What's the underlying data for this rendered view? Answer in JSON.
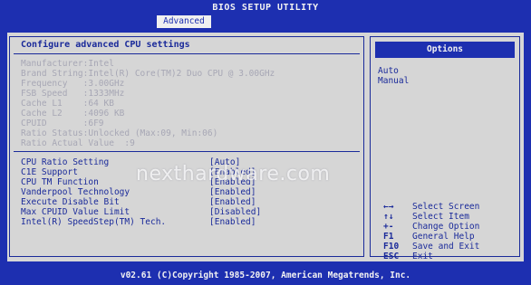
{
  "header": {
    "title": "BIOS SETUP UTILITY",
    "active_tab": "Advanced"
  },
  "left": {
    "heading": "Configure advanced CPU settings",
    "info": [
      "Manufacturer:Intel",
      "Brand String:Intel(R) Core(TM)2 Duo CPU @ 3.00GHz",
      "Frequency   :3.00GHz",
      "FSB Speed   :1333MHz",
      "Cache L1    :64 KB",
      "Cache L2    :4096 KB",
      "CPUID       :6F9",
      "Ratio Status:Unlocked (Max:09, Min:06)",
      "Ratio Actual Value  :9"
    ],
    "settings": [
      {
        "name": "CPU Ratio Setting",
        "value": "[Auto]"
      },
      {
        "name": "C1E Support",
        "value": "[Enabled]"
      },
      {
        "name": "CPU TM Function",
        "value": "[Enabled]"
      },
      {
        "name": "Vanderpool Technology",
        "value": "[Enabled]"
      },
      {
        "name": "Execute Disable Bit",
        "value": "[Enabled]"
      },
      {
        "name": "Max CPUID Value Limit",
        "value": "[Disabled]"
      },
      {
        "name": "Intel(R) SpeedStep(TM) Tech.",
        "value": "[Enabled]"
      }
    ]
  },
  "right": {
    "header": "Options",
    "options": [
      "Auto",
      "Manual"
    ],
    "help": [
      {
        "key": "←→",
        "desc": "Select Screen"
      },
      {
        "key": "↑↓",
        "desc": "Select Item"
      },
      {
        "key": "+-",
        "desc": "Change Option"
      },
      {
        "key": "F1",
        "desc": "General Help"
      },
      {
        "key": "F10",
        "desc": "Save and Exit"
      },
      {
        "key": "ESC",
        "desc": "Exit"
      }
    ]
  },
  "watermark": "nexthardware.com",
  "footer": "v02.61 (C)Copyright 1985-2007, American Megatrends, Inc."
}
